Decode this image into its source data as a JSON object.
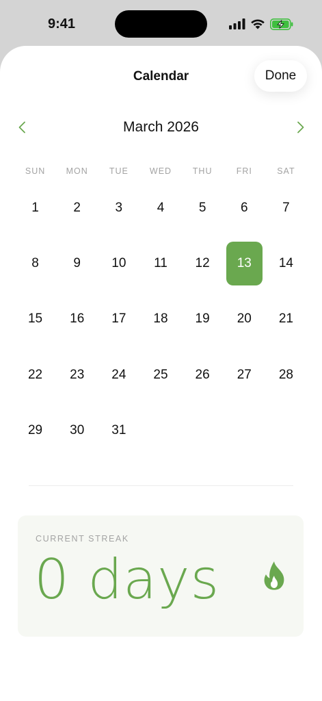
{
  "status_bar": {
    "time": "9:41",
    "icons": [
      "signal-icon",
      "wifi-icon",
      "battery-charging-icon"
    ],
    "battery_color": "#3fbf3f"
  },
  "sheet": {
    "title": "Calendar",
    "done_label": "Done"
  },
  "calendar": {
    "month_title": "March 2026",
    "prev_icon": "chevron-left-icon",
    "next_icon": "chevron-right-icon",
    "weekdays": [
      "SUN",
      "MON",
      "TUE",
      "WED",
      "THU",
      "FRI",
      "SAT"
    ],
    "days": [
      "1",
      "2",
      "3",
      "4",
      "5",
      "6",
      "7",
      "8",
      "9",
      "10",
      "11",
      "12",
      "13",
      "14",
      "15",
      "16",
      "17",
      "18",
      "19",
      "20",
      "21",
      "22",
      "23",
      "24",
      "25",
      "26",
      "27",
      "28",
      "29",
      "30",
      "31"
    ],
    "selected_day": "13",
    "accent_color": "#6aa84f"
  },
  "streak": {
    "label": "CURRENT STREAK",
    "value": "0",
    "unit": "days",
    "icon": "flame-icon"
  }
}
